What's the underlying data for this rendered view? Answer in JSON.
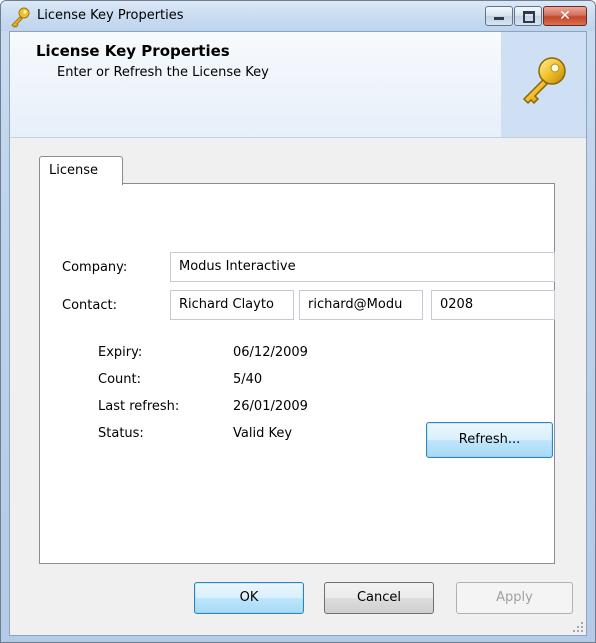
{
  "window": {
    "title": "License Key Properties"
  },
  "header": {
    "title": "License Key Properties",
    "subtitle": "Enter or Refresh the License Key"
  },
  "tabs": [
    {
      "label": "License",
      "active": true
    }
  ],
  "form": {
    "company_label": "Company:",
    "company_value": "Modus Interactive",
    "contact_label": "Contact:",
    "contact_name": "Richard Clayto",
    "contact_email": "richard@Modu",
    "contact_phone": "0208"
  },
  "info": {
    "expiry_label": "Expiry:",
    "expiry_value": "06/12/2009",
    "count_label": "Count:",
    "count_value": "5/40",
    "last_refresh_label": "Last refresh:",
    "last_refresh_value": "26/01/2009",
    "status_label": "Status:",
    "status_value": "Valid Key"
  },
  "buttons": {
    "refresh": "Refresh...",
    "ok": "OK",
    "cancel": "Cancel",
    "apply": "Apply"
  },
  "icons": {
    "title": "key-icon",
    "header": "key-icon"
  },
  "colors": {
    "titlebar": "#c7daf0",
    "close_button": "#c2472b",
    "header_band": "#e7eff9",
    "key_gold": "#e8b520"
  }
}
